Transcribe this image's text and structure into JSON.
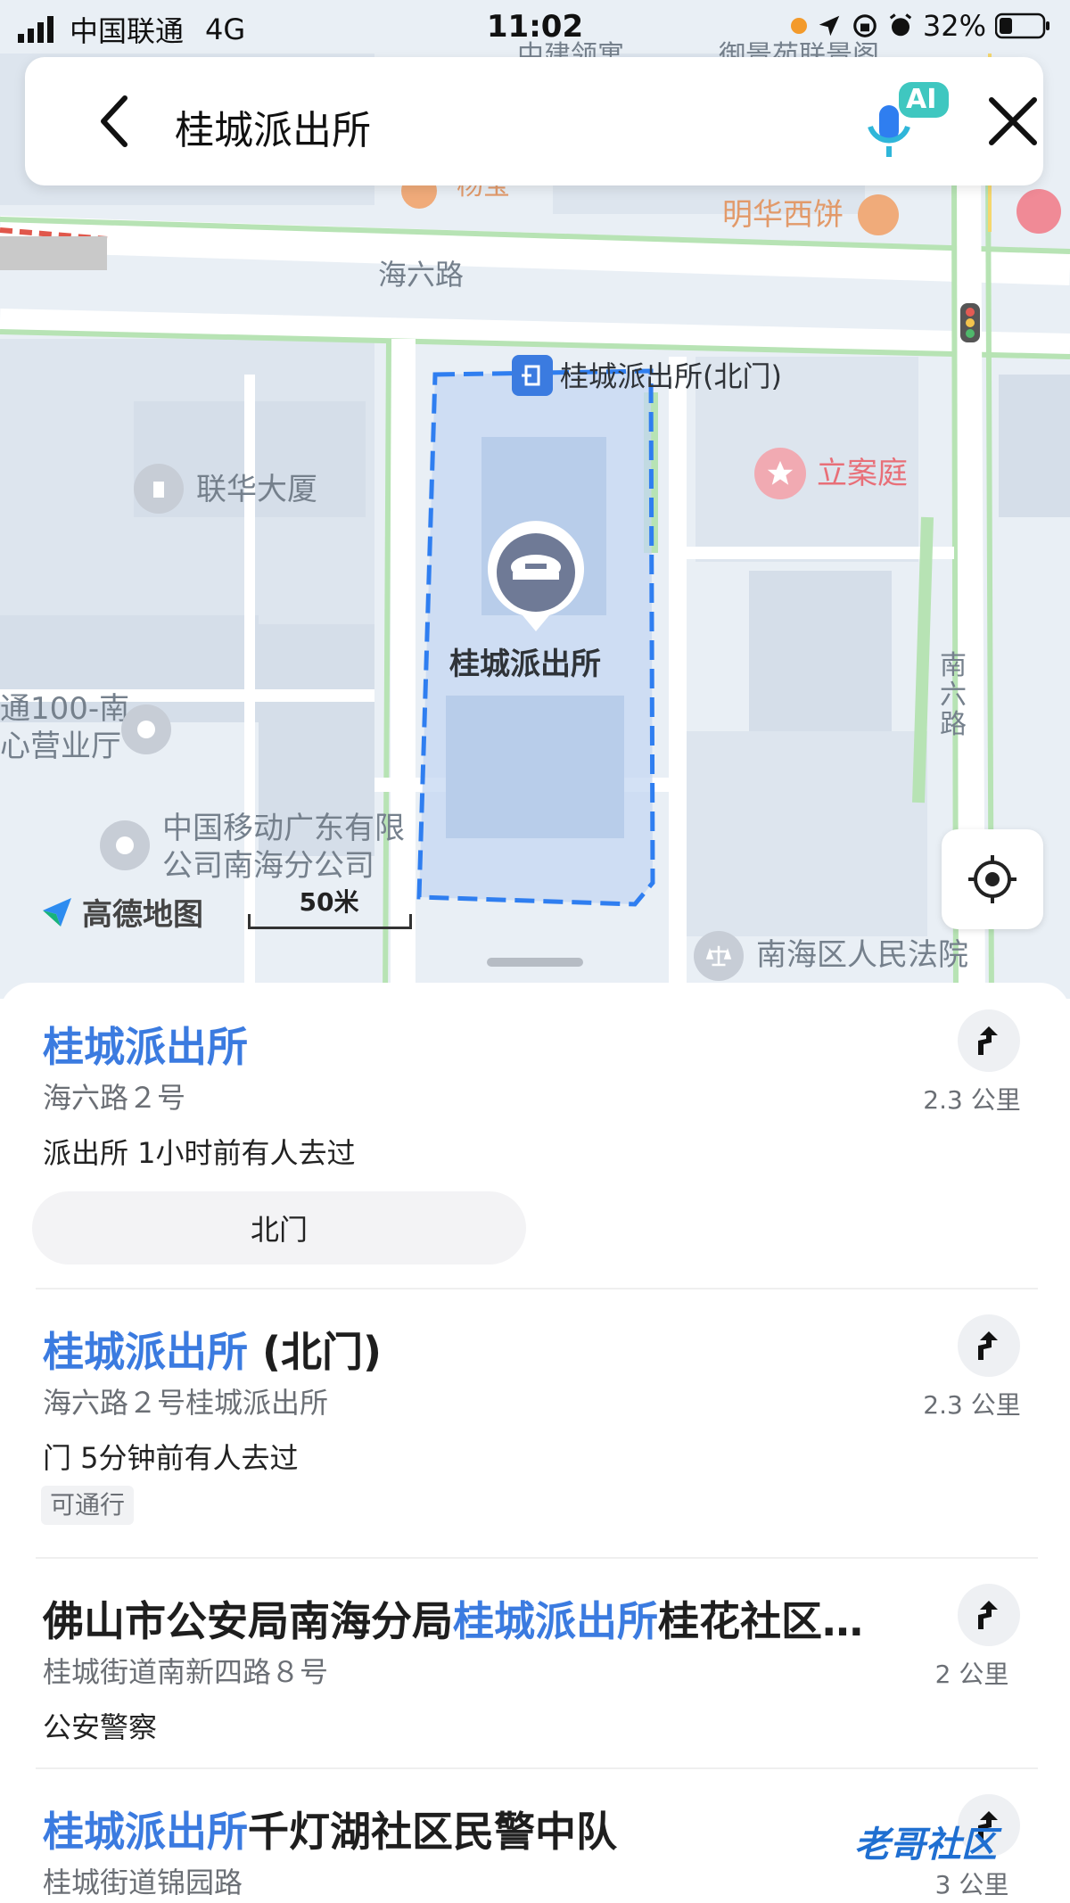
{
  "status_bar": {
    "carrier": "中国联通",
    "network": "4G",
    "time": "11:02",
    "battery": "32%"
  },
  "search": {
    "query": "桂城派出所",
    "ai_badge": "AI"
  },
  "map": {
    "labels": {
      "hai_liu_road": "海六路",
      "north_gate": "桂城派出所(北门)",
      "lianhua": "联华大厦",
      "lian_ting": "立案庭",
      "minghua": "明华西饼",
      "station": "桂城派出所",
      "business_hall": "通100-南",
      "business_hall_2": "心营业厅",
      "china_mobile_1": "中国移动广东有限",
      "china_mobile_2": "公司南海分公司",
      "nan_liu_road": "南六路",
      "court": "南海区人民法院",
      "top_partial_1": "中建领寓",
      "top_partial_2": "御景苑联景阁",
      "yang_partial": "杨宝"
    },
    "logo_text": "高德地图",
    "scale_text": "50米"
  },
  "results": [
    {
      "title_highlight": "桂城派出所",
      "title_rest": "",
      "address": "海六路２号",
      "meta": "派出所  1小时前有人去过",
      "distance": "2.3 公里",
      "chip": "北门"
    },
    {
      "title_highlight": "桂城派出所",
      "title_rest": " (北门)",
      "address": "海六路２号桂城派出所",
      "meta": "门  5分钟前有人去过",
      "distance": "2.3 公里",
      "tag": "可通行"
    },
    {
      "title_prefix": "佛山市公安局南海分局",
      "title_highlight": "桂城派出所",
      "title_rest": "桂花社区…",
      "address": "桂城街道南新四路８号",
      "meta": "公安警察",
      "distance": "2 公里"
    },
    {
      "title_highlight": "桂城派出所",
      "title_rest": "千灯湖社区民警中队",
      "address": "桂城街道锦园路",
      "distance": "3 公里"
    }
  ],
  "watermark": "老哥社区",
  "colors": {
    "accent_blue": "#3b7be0",
    "green_road": "#b7e3b4",
    "boundary": "#2f7ef0"
  }
}
